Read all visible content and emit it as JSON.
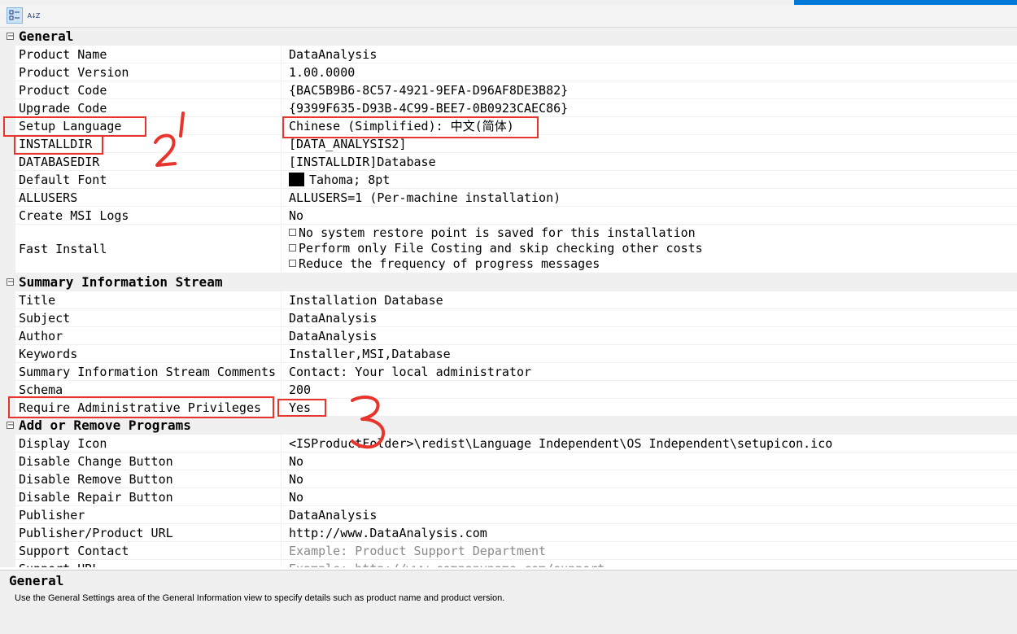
{
  "toolbar": {
    "buttons": [
      {
        "icon": "categorized-view-icon",
        "pressed": true
      },
      {
        "icon": "alphabetical-sort-icon",
        "glyph": "A↓Z",
        "pressed": false
      }
    ]
  },
  "categories": [
    {
      "label": "General",
      "properties": [
        {
          "name": "Product Name",
          "value": "DataAnalysis"
        },
        {
          "name": "Product Version",
          "value": "1.00.0000"
        },
        {
          "name": "Product Code",
          "value": "{BAC5B9B6-8C57-4921-9EFA-D96AF8DE3B82}"
        },
        {
          "name": "Upgrade Code",
          "value": "{9399F635-D93B-4C99-BEE7-0B0923CAEC86}"
        },
        {
          "name": "Setup Language",
          "value": "Chinese (Simplified): 中文(简体)"
        },
        {
          "name": "INSTALLDIR",
          "value": "[DATA_ANALYSIS2]"
        },
        {
          "name": "DATABASEDIR",
          "value": "[INSTALLDIR]Database"
        },
        {
          "name": "Default Font",
          "value": "Tahoma; 8pt"
        },
        {
          "name": "ALLUSERS",
          "value": "ALLUSERS=1 (Per-machine installation)"
        },
        {
          "name": "Create MSI Logs",
          "value": "No"
        },
        {
          "name": "Fast Install",
          "options": [
            {
              "label": "No system restore point is saved for this installation",
              "checked": false
            },
            {
              "label": "Perform only File Costing and skip checking other costs",
              "checked": false
            },
            {
              "label": "Reduce the frequency of progress messages",
              "checked": false
            }
          ]
        }
      ]
    },
    {
      "label": "Summary Information Stream",
      "properties": [
        {
          "name": "Title",
          "value": "Installation Database"
        },
        {
          "name": "Subject",
          "value": "DataAnalysis"
        },
        {
          "name": "Author",
          "value": "DataAnalysis"
        },
        {
          "name": "Keywords",
          "value": "Installer,MSI,Database"
        },
        {
          "name": "Summary Information Stream Comments",
          "value": "Contact:  Your local administrator"
        },
        {
          "name": "Schema",
          "value": "200"
        },
        {
          "name": "Require Administrative Privileges",
          "value": "Yes"
        }
      ]
    },
    {
      "label": "Add or Remove Programs",
      "properties": [
        {
          "name": "Display Icon",
          "value": "<ISProductFolder>\\redist\\Language Independent\\OS Independent\\setupicon.ico"
        },
        {
          "name": "Disable Change Button",
          "value": "No"
        },
        {
          "name": "Disable Remove Button",
          "value": "No"
        },
        {
          "name": "Disable Repair Button",
          "value": "No"
        },
        {
          "name": "Publisher",
          "value": "DataAnalysis"
        },
        {
          "name": "Publisher/Product URL",
          "value": "http://www.DataAnalysis.com"
        },
        {
          "name": "Support Contact",
          "value": "Example: Product Support Department",
          "placeholder": true
        },
        {
          "name": "Support URL",
          "value": "Example: http://www.companyname.com/support",
          "placeholder": true
        }
      ]
    }
  ],
  "description": {
    "title": "General",
    "text": "Use the General Settings area of the General Information view to specify details such as product name and product version."
  },
  "annotations": {
    "color": "#e8342a",
    "numbers": [
      "2",
      "3"
    ]
  },
  "colors": {
    "category_bg": "#f0f0f0",
    "selection_accent": "#0078d7",
    "annotation_red": "#e8342a"
  }
}
